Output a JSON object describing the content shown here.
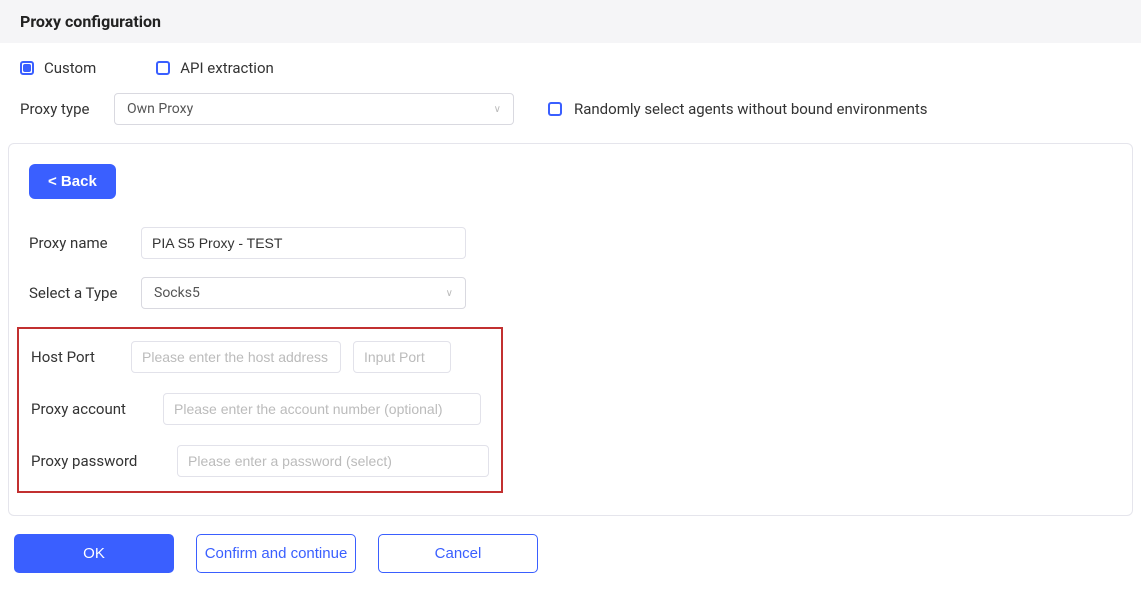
{
  "header": {
    "title": "Proxy configuration"
  },
  "mode": {
    "custom_label": "Custom",
    "api_label": "API extraction"
  },
  "proxy_type": {
    "label": "Proxy type",
    "value": "Own Proxy"
  },
  "random_checkbox": {
    "label": "Randomly select agents without bound environments"
  },
  "panel": {
    "back_label": "< Back",
    "proxy_name": {
      "label": "Proxy name",
      "value": "PIA S5 Proxy - TEST"
    },
    "select_type": {
      "label": "Select a Type",
      "value": "Socks5"
    },
    "host_port": {
      "label": "Host Port",
      "host_placeholder": "Please enter the host address",
      "port_placeholder": "Input Port"
    },
    "proxy_account": {
      "label": "Proxy account",
      "placeholder": "Please enter the account number (optional)"
    },
    "proxy_password": {
      "label": "Proxy password",
      "placeholder": "Please enter a password (select)"
    }
  },
  "footer": {
    "ok": "OK",
    "confirm": "Confirm and continue",
    "cancel": "Cancel"
  }
}
